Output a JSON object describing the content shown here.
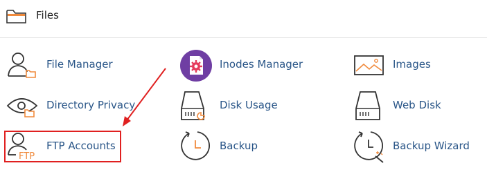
{
  "section": {
    "title": "Files",
    "icon": "folder-icon"
  },
  "tools": [
    {
      "label": "File Manager",
      "icon": "file-manager-icon"
    },
    {
      "label": "Inodes Manager",
      "icon": "inodes-manager-icon"
    },
    {
      "label": "Images",
      "icon": "images-icon"
    },
    {
      "label": "Directory Privacy",
      "icon": "directory-privacy-icon"
    },
    {
      "label": "Disk Usage",
      "icon": "disk-usage-icon"
    },
    {
      "label": "Web Disk",
      "icon": "web-disk-icon"
    },
    {
      "label": "FTP Accounts",
      "icon": "ftp-accounts-icon",
      "icon_text": "FTP",
      "highlighted": true
    },
    {
      "label": "Backup",
      "icon": "backup-icon"
    },
    {
      "label": "Backup Wizard",
      "icon": "backup-wizard-icon"
    }
  ],
  "colors": {
    "link": "#2a5688",
    "accent_orange": "#f08a3c",
    "inodes_purple": "#6f3ea3",
    "highlight_red": "#e02020"
  }
}
